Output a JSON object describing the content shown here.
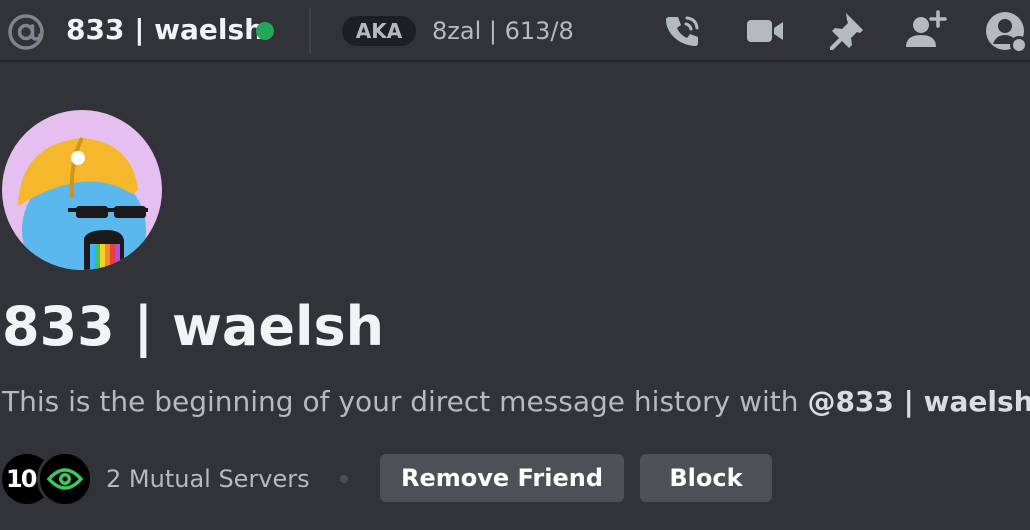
{
  "header": {
    "dm_name": "833 | waelsh",
    "status": "online",
    "status_color": "#23a55a",
    "aka_label": "AKA",
    "aka_names": "8zal | 613/8",
    "icons": [
      "voice-call-icon",
      "video-call-icon",
      "pinned-messages-icon",
      "add-friends-to-dm-icon",
      "user-profile-icon"
    ]
  },
  "welcome": {
    "name": "833 | waelsh",
    "intro_prefix": "This is the beginning of your direct message history with ",
    "intro_mention": "@833 | waelsh",
    "intro_suffix": "."
  },
  "mutual": {
    "server1_abbrev": "10(",
    "servers_label": "2 Mutual Servers"
  },
  "actions": {
    "remove_friend_label": "Remove Friend",
    "block_label": "Block"
  },
  "colors": {
    "background": "#313338",
    "button": "#4e5058",
    "avatar_bg": "#e6bff1"
  }
}
